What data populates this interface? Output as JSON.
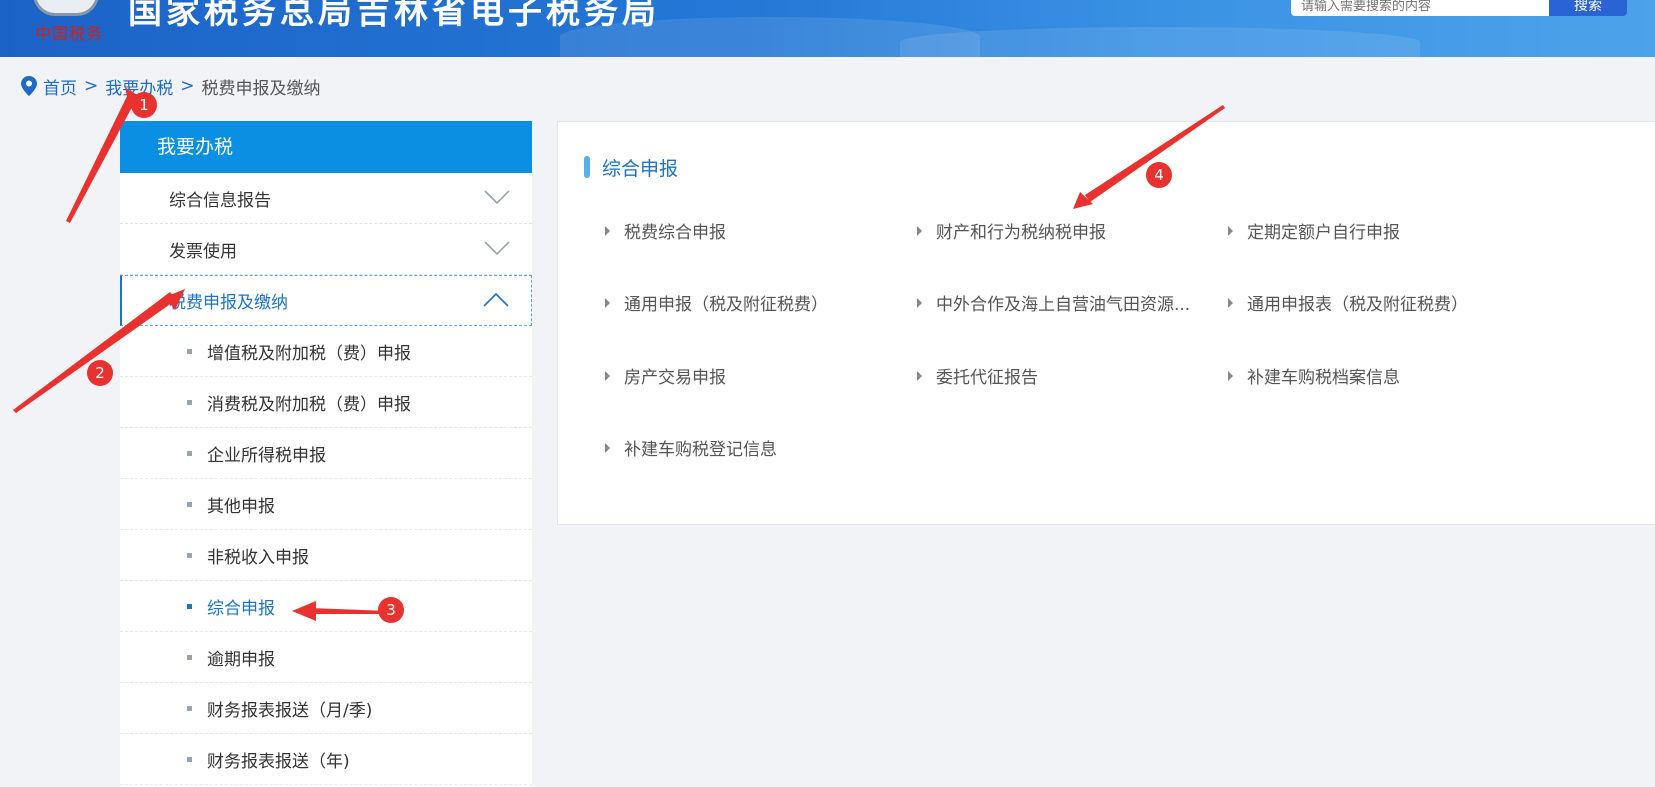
{
  "header": {
    "site_title": "国家税务总局吉林省电子税务局",
    "logo_text": "中国税务",
    "search_placeholder": "请输入需要搜索的内容",
    "search_button": "搜索"
  },
  "breadcrumb": {
    "home": "首页",
    "sep1": ">",
    "level1": "我要办税",
    "sep2": ">",
    "current": "税费申报及缴纳"
  },
  "sidebar": {
    "heading": "我要办税",
    "groups": [
      {
        "label": "综合信息报告",
        "expanded": false
      },
      {
        "label": "发票使用",
        "expanded": false
      },
      {
        "label": "税费申报及缴纳",
        "expanded": true
      }
    ],
    "items": [
      {
        "label": "增值税及附加税（费）申报"
      },
      {
        "label": "消费税及附加税（费）申报"
      },
      {
        "label": "企业所得税申报"
      },
      {
        "label": "其他申报"
      },
      {
        "label": "非税收入申报"
      },
      {
        "label": "综合申报",
        "current": true
      },
      {
        "label": "逾期申报"
      },
      {
        "label": "财务报表报送（月/季)"
      },
      {
        "label": "财务报表报送（年)"
      }
    ]
  },
  "panel": {
    "title": "综合申报",
    "links": [
      "税费综合申报",
      "财产和行为税纳税申报",
      "定期定额户自行申报",
      "通用申报（税及附征税费）",
      "中外合作及海上自营油气田资源...",
      "通用申报表（税及附征税费）",
      "房产交易申报",
      "委托代征报告",
      "补建车购税档案信息",
      "补建车购税登记信息"
    ]
  },
  "annotations": {
    "badges": [
      "1",
      "2",
      "3",
      "4"
    ],
    "arrow_color": "#e8322f"
  },
  "colors": {
    "header_blue": "#2478d6",
    "sidebar_head": "#0a8fe3",
    "active_link": "#1d72c9",
    "annotation_red": "#e8322f"
  }
}
